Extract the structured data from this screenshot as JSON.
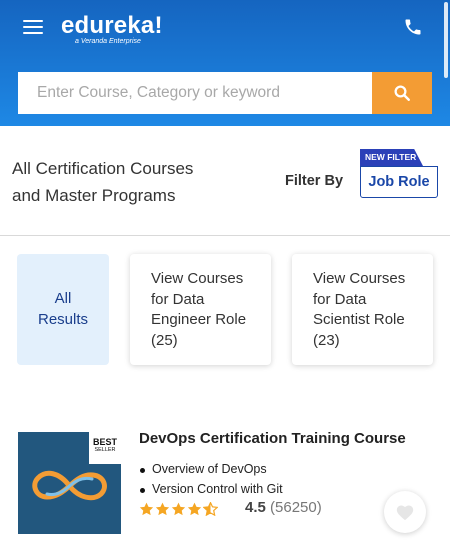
{
  "header": {
    "logo": "edureka!",
    "logo_tagline": "a Veranda Enterprise",
    "menu_icon": "hamburger-menu-icon",
    "phone_icon": "phone-icon",
    "background_color": "#1565c0"
  },
  "search": {
    "placeholder": "Enter Course, Category or keyword",
    "value": "",
    "button_icon": "search-icon",
    "button_color": "#f39c34"
  },
  "listing": {
    "title_line1": "All Certification Courses",
    "title_line2": "and Master Programs",
    "filter_label": "Filter By",
    "new_filter_badge": "NEW FILTER",
    "filter_button": "Job Role"
  },
  "role_cards": [
    {
      "line1": "All",
      "line2": "Results",
      "selected": true
    },
    {
      "line1": "View Courses",
      "line2": "for Data",
      "line3": "Engineer Role",
      "line4": "(25)",
      "selected": false
    },
    {
      "line1": "View Courses",
      "line2": "for Data",
      "line3": "Scientist Role",
      "line4": "(23)",
      "selected": false
    }
  ],
  "courses": [
    {
      "title": "DevOps Certification Training Course",
      "badge_line1": "BEST",
      "badge_line2": "SELLER",
      "bullets": [
        "Overview of DevOps",
        "Version Control with Git"
      ],
      "rating": "4.5",
      "rating_count": "(56250)",
      "stars": 4.5,
      "star_color": "#f5a623",
      "wishlist_icon": "heart-icon"
    }
  ]
}
